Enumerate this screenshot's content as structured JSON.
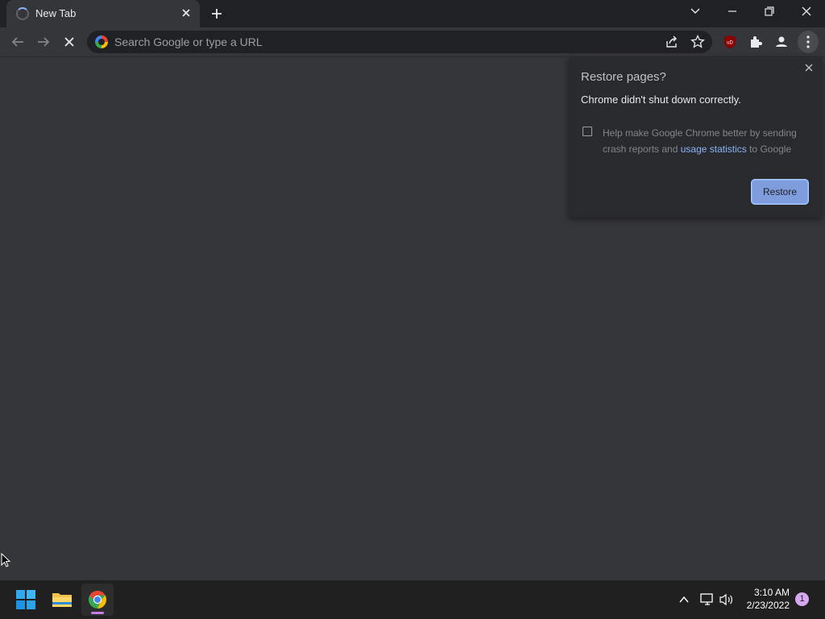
{
  "browser": {
    "tab": {
      "title": "New Tab"
    },
    "omnibox": {
      "placeholder": "Search Google or type a URL",
      "value": ""
    }
  },
  "popup": {
    "title": "Restore pages?",
    "subtitle": "Chrome didn't shut down correctly.",
    "checkbox": {
      "checked": false,
      "text_before": "Help make Google Chrome better by sending crash reports and ",
      "link": "usage statistics",
      "text_after": " to Google"
    },
    "restore_label": "Restore"
  },
  "extensions": {
    "ublock_badge": "uD"
  },
  "taskbar": {
    "time": "3:10 AM",
    "date": "2/23/2022",
    "notification_count": "1"
  },
  "colors": {
    "page_bg": "#35363a",
    "titlebar_bg": "#202124",
    "accent": "#8ab4f8",
    "restore_button": "#7f9ddd",
    "taskbar_bg": "#202020"
  }
}
